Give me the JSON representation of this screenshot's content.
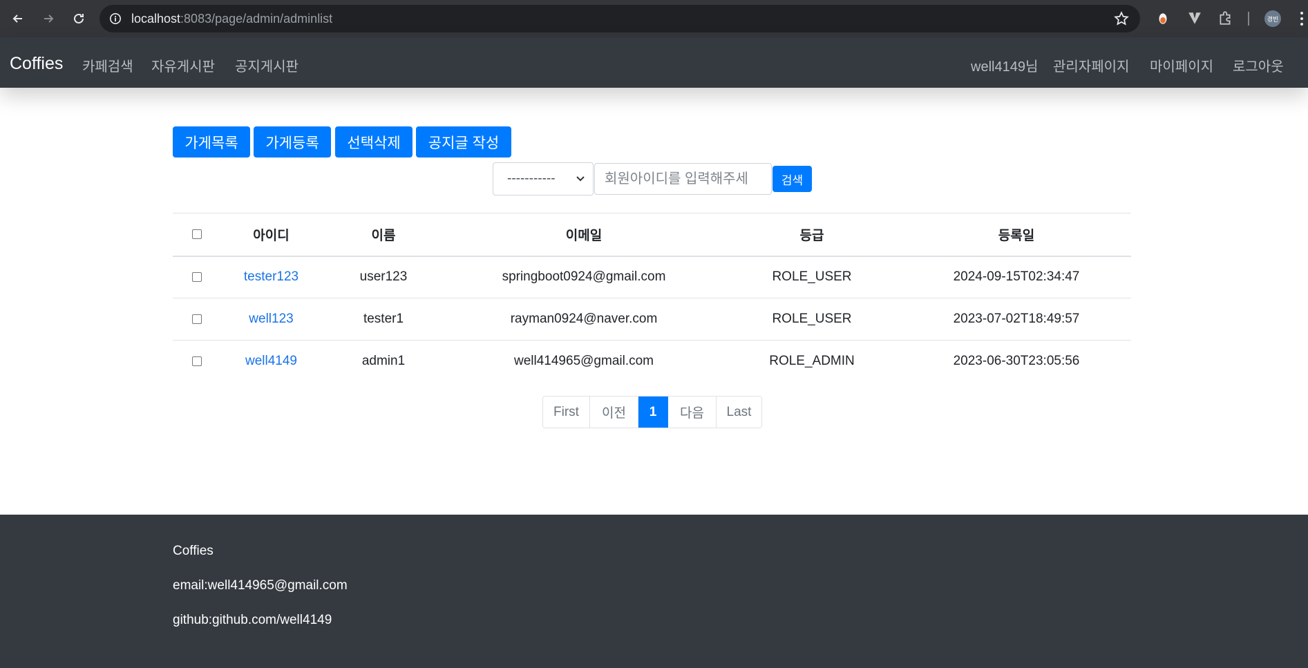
{
  "browser": {
    "url_host": "localhost",
    "url_path": ":8083/page/admin/adminlist",
    "profile_initials": "경빈"
  },
  "navbar": {
    "brand": "Coffies",
    "left_links": [
      "카페검색",
      "자유게시판",
      "공지게시판"
    ],
    "user_greeting": "well4149님",
    "right_links": [
      "관리자페이지",
      "마이페이지",
      "로그아웃"
    ]
  },
  "toolbar": {
    "store_list": "가게목록",
    "store_register": "가게등록",
    "delete_selected": "선택삭제",
    "write_notice": "공지글 작성"
  },
  "search": {
    "select_value": "-----------",
    "placeholder": "회원아이디를 입력해주세",
    "button": "검색"
  },
  "table": {
    "headers": [
      "",
      "아이디",
      "이름",
      "이메일",
      "등급",
      "등록일"
    ],
    "rows": [
      {
        "id": "tester123",
        "name": "user123",
        "email": "springboot0924@gmail.com",
        "role": "ROLE_USER",
        "created": "2024-09-15T02:34:47"
      },
      {
        "id": "well123",
        "name": "tester1",
        "email": "rayman0924@naver.com",
        "role": "ROLE_USER",
        "created": "2023-07-02T18:49:57"
      },
      {
        "id": "well4149",
        "name": "admin1",
        "email": "well414965@gmail.com",
        "role": "ROLE_ADMIN",
        "created": "2023-06-30T23:05:56"
      }
    ]
  },
  "pagination": {
    "first": "First",
    "prev": "이전",
    "current": "1",
    "next": "다음",
    "last": "Last"
  },
  "footer": {
    "name": "Coffies",
    "email": "email:well414965@gmail.com",
    "github": "github:github.com/well4149"
  },
  "colors": {
    "primary": "#007bff",
    "navbar_bg": "#343a40",
    "link": "#1a73e8"
  }
}
